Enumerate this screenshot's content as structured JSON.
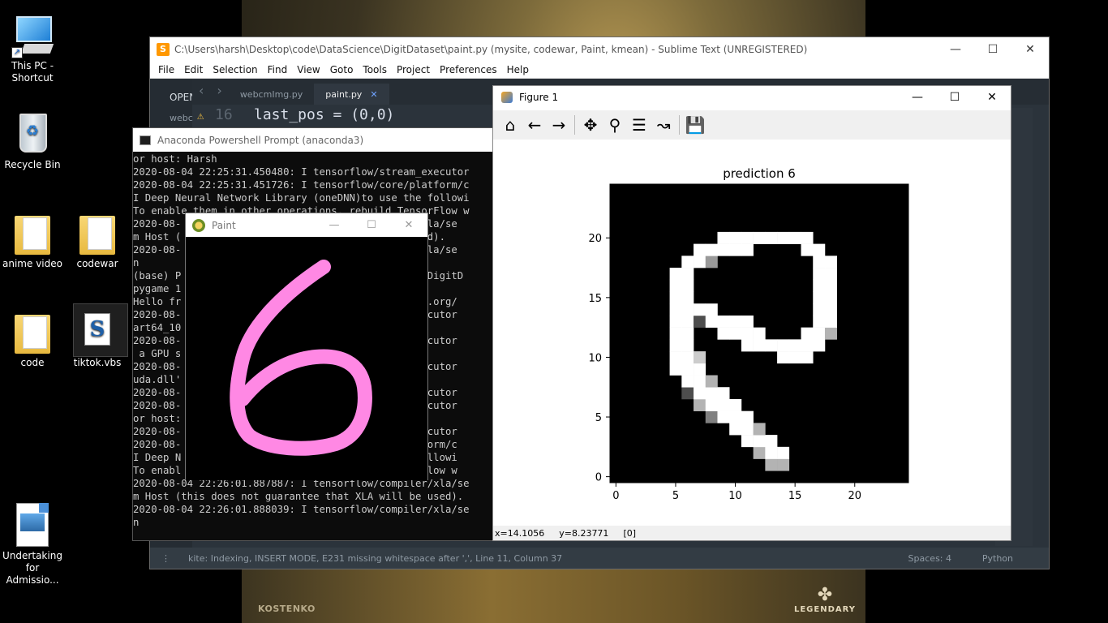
{
  "desktop": {
    "icons": [
      {
        "label_line1": "This PC -",
        "label_line2": "Shortcut",
        "icon": "computer-icon"
      },
      {
        "label_line1": "Recycle Bin",
        "label_line2": "",
        "icon": "recycle-bin-icon"
      },
      {
        "label_line1": "anime video",
        "label_line2": "",
        "icon": "folder-icon"
      },
      {
        "label_line1": "codewar",
        "label_line2": "",
        "icon": "folder-icon"
      },
      {
        "label_line1": "code",
        "label_line2": "",
        "icon": "folder-icon"
      },
      {
        "label_line1": "tiktok.vbs",
        "label_line2": "",
        "icon": "script-file-icon"
      },
      {
        "label_line1": "Undertaking",
        "label_line2": "for Admissio...",
        "icon": "document-icon"
      }
    ],
    "wallpaper_left_text": "KOSTENKO",
    "wallpaper_logo_text": "LEGENDARY"
  },
  "sublime": {
    "title": "C:\\Users\\harsh\\Desktop\\code\\DataScience\\DigitDataset\\paint.py (mysite, codewar, Paint, kmean) - Sublime Text (UNREGISTERED)",
    "menu": [
      "File",
      "Edit",
      "Selection",
      "Find",
      "View",
      "Goto",
      "Tools",
      "Project",
      "Preferences",
      "Help"
    ],
    "sidebar_open": "OPEN",
    "sidebar_file": "webc",
    "tabs": [
      "webcmImg.py",
      "paint.py"
    ],
    "line_number": "16",
    "code_line": "last_pos = (0,0)",
    "status_left": "kite: Indexing, INSERT MODE, E231 missing whitespace after ',', Line 11, Column 37",
    "status_spaces": "Spaces: 4",
    "status_lang": "Python"
  },
  "conda": {
    "title": "Anaconda Powershell Prompt (anaconda3)",
    "lines": [
      "or host: Harsh",
      "2020-08-04 22:25:31.450480: I tensorflow/stream_executor",
      "2020-08-04 22:25:31.451726: I tensorflow/core/platform/c",
      "I Deep Neural Network Library (oneDNN)to use the followi",
      "To enable them in other operations, rebuild TensorFlow w",
      "2020-08-                                   ller/xla/se",
      "m Host (                                   be used).",
      "2020-08-                                   ller/xla/se",
      "n",
      "(base) P                                   ience\\DigitD",
      "pygame 1                                   ",
      "Hello fr                                   pygame.org/",
      "2020-08-                                   am_executor",
      "art64_10                                    found",
      "2020-08-                                   am_executor",
      " a GPU s",
      "2020-08-                                   am_executor",
      "uda.dll'",
      "2020-08-                                   am_executor",
      "2020-08-                                   am_executor",
      "or host:",
      "2020-08-                                   am_executor",
      "2020-08-                                   /platform/c",
      "I Deep N                                   the followi",
      "To enabl                                   ensorFlow w",
      "2020-08-04 22:26:01.887887: I tensorflow/compiler/xla/se",
      "m Host (this does not guarantee that XLA will be used).",
      "2020-08-04 22:26:01.888039: I tensorflow/compiler/xla/se",
      "n"
    ]
  },
  "paint": {
    "title": "Paint",
    "stroke_color": "#ff88e4"
  },
  "figure": {
    "title": "Figure 1",
    "toolbar": [
      "home-icon",
      "back-arrow-icon",
      "forward-arrow-icon",
      "pan-icon",
      "zoom-icon",
      "configure-subplots-icon",
      "edit-axis-icon",
      "save-icon"
    ],
    "status_x": "x=14.1056",
    "status_y": "y=8.23771",
    "status_val": "[0]"
  },
  "chart_data": {
    "type": "heatmap",
    "title": "prediction 6",
    "cmap": "gray",
    "xticks": [
      0,
      5,
      10,
      15,
      20
    ],
    "yticks": [
      0,
      5,
      10,
      15,
      20
    ],
    "xlim": [
      -0.5,
      24.5
    ],
    "ylim": [
      24.5,
      -0.5
    ],
    "grid": false,
    "pixels": [
      {
        "r": 2,
        "c": 13,
        "v": 0.7
      },
      {
        "r": 2,
        "c": 14,
        "v": 0.7
      },
      {
        "r": 3,
        "c": 12,
        "v": 0.7
      },
      {
        "r": 3,
        "c": 13,
        "v": 1
      },
      {
        "r": 3,
        "c": 14,
        "v": 1
      },
      {
        "r": 4,
        "c": 11,
        "v": 1
      },
      {
        "r": 4,
        "c": 12,
        "v": 1
      },
      {
        "r": 4,
        "c": 13,
        "v": 1
      },
      {
        "r": 5,
        "c": 10,
        "v": 1
      },
      {
        "r": 5,
        "c": 11,
        "v": 1
      },
      {
        "r": 5,
        "c": 12,
        "v": 0.7
      },
      {
        "r": 6,
        "c": 8,
        "v": 0.5
      },
      {
        "r": 6,
        "c": 9,
        "v": 1
      },
      {
        "r": 6,
        "c": 10,
        "v": 1
      },
      {
        "r": 6,
        "c": 11,
        "v": 1
      },
      {
        "r": 7,
        "c": 7,
        "v": 0.7
      },
      {
        "r": 7,
        "c": 8,
        "v": 1
      },
      {
        "r": 7,
        "c": 9,
        "v": 1
      },
      {
        "r": 7,
        "c": 10,
        "v": 1
      },
      {
        "r": 8,
        "c": 6,
        "v": 0.3
      },
      {
        "r": 8,
        "c": 7,
        "v": 1
      },
      {
        "r": 8,
        "c": 8,
        "v": 1
      },
      {
        "r": 8,
        "c": 9,
        "v": 1
      },
      {
        "r": 9,
        "c": 6,
        "v": 1
      },
      {
        "r": 9,
        "c": 7,
        "v": 1
      },
      {
        "r": 9,
        "c": 8,
        "v": 0.7
      },
      {
        "r": 10,
        "c": 5,
        "v": 1
      },
      {
        "r": 10,
        "c": 6,
        "v": 1
      },
      {
        "r": 10,
        "c": 7,
        "v": 1
      },
      {
        "r": 11,
        "c": 5,
        "v": 1
      },
      {
        "r": 11,
        "c": 6,
        "v": 1
      },
      {
        "r": 11,
        "c": 7,
        "v": 0.8
      },
      {
        "r": 11,
        "c": 14,
        "v": 1
      },
      {
        "r": 11,
        "c": 15,
        "v": 1
      },
      {
        "r": 11,
        "c": 16,
        "v": 1
      },
      {
        "r": 12,
        "c": 5,
        "v": 1
      },
      {
        "r": 12,
        "c": 6,
        "v": 1
      },
      {
        "r": 12,
        "c": 11,
        "v": 1
      },
      {
        "r": 12,
        "c": 12,
        "v": 1
      },
      {
        "r": 12,
        "c": 13,
        "v": 1
      },
      {
        "r": 12,
        "c": 14,
        "v": 1
      },
      {
        "r": 12,
        "c": 15,
        "v": 1
      },
      {
        "r": 12,
        "c": 16,
        "v": 1
      },
      {
        "r": 12,
        "c": 17,
        "v": 1
      },
      {
        "r": 13,
        "c": 5,
        "v": 1
      },
      {
        "r": 13,
        "c": 6,
        "v": 1
      },
      {
        "r": 13,
        "c": 9,
        "v": 1
      },
      {
        "r": 13,
        "c": 10,
        "v": 1
      },
      {
        "r": 13,
        "c": 11,
        "v": 1
      },
      {
        "r": 13,
        "c": 12,
        "v": 1
      },
      {
        "r": 13,
        "c": 16,
        "v": 1
      },
      {
        "r": 13,
        "c": 17,
        "v": 1
      },
      {
        "r": 13,
        "c": 18,
        "v": 0.7
      },
      {
        "r": 14,
        "c": 5,
        "v": 1
      },
      {
        "r": 14,
        "c": 6,
        "v": 1
      },
      {
        "r": 14,
        "c": 7,
        "v": 0.3
      },
      {
        "r": 14,
        "c": 8,
        "v": 1
      },
      {
        "r": 14,
        "c": 9,
        "v": 1
      },
      {
        "r": 14,
        "c": 10,
        "v": 1
      },
      {
        "r": 14,
        "c": 11,
        "v": 1
      },
      {
        "r": 14,
        "c": 17,
        "v": 1
      },
      {
        "r": 14,
        "c": 18,
        "v": 1
      },
      {
        "r": 15,
        "c": 5,
        "v": 1
      },
      {
        "r": 15,
        "c": 6,
        "v": 1
      },
      {
        "r": 15,
        "c": 7,
        "v": 1
      },
      {
        "r": 15,
        "c": 8,
        "v": 1
      },
      {
        "r": 15,
        "c": 17,
        "v": 1
      },
      {
        "r": 15,
        "c": 18,
        "v": 1
      },
      {
        "r": 16,
        "c": 5,
        "v": 1
      },
      {
        "r": 16,
        "c": 6,
        "v": 1
      },
      {
        "r": 16,
        "c": 17,
        "v": 1
      },
      {
        "r": 16,
        "c": 18,
        "v": 1
      },
      {
        "r": 17,
        "c": 5,
        "v": 1
      },
      {
        "r": 17,
        "c": 6,
        "v": 1
      },
      {
        "r": 17,
        "c": 17,
        "v": 1
      },
      {
        "r": 17,
        "c": 18,
        "v": 1
      },
      {
        "r": 18,
        "c": 5,
        "v": 1
      },
      {
        "r": 18,
        "c": 6,
        "v": 1
      },
      {
        "r": 18,
        "c": 17,
        "v": 1
      },
      {
        "r": 18,
        "c": 18,
        "v": 1
      },
      {
        "r": 19,
        "c": 6,
        "v": 1
      },
      {
        "r": 19,
        "c": 7,
        "v": 1
      },
      {
        "r": 19,
        "c": 8,
        "v": 0.6
      },
      {
        "r": 19,
        "c": 17,
        "v": 1
      },
      {
        "r": 19,
        "c": 18,
        "v": 1
      },
      {
        "r": 20,
        "c": 7,
        "v": 1
      },
      {
        "r": 20,
        "c": 8,
        "v": 1
      },
      {
        "r": 20,
        "c": 9,
        "v": 1
      },
      {
        "r": 20,
        "c": 10,
        "v": 1
      },
      {
        "r": 20,
        "c": 11,
        "v": 1
      },
      {
        "r": 20,
        "c": 16,
        "v": 1
      },
      {
        "r": 20,
        "c": 17,
        "v": 1
      },
      {
        "r": 21,
        "c": 9,
        "v": 1
      },
      {
        "r": 21,
        "c": 10,
        "v": 1
      },
      {
        "r": 21,
        "c": 11,
        "v": 1
      },
      {
        "r": 21,
        "c": 12,
        "v": 1
      },
      {
        "r": 21,
        "c": 13,
        "v": 1
      },
      {
        "r": 21,
        "c": 14,
        "v": 1
      },
      {
        "r": 21,
        "c": 15,
        "v": 1
      },
      {
        "r": 21,
        "c": 16,
        "v": 1
      }
    ]
  }
}
